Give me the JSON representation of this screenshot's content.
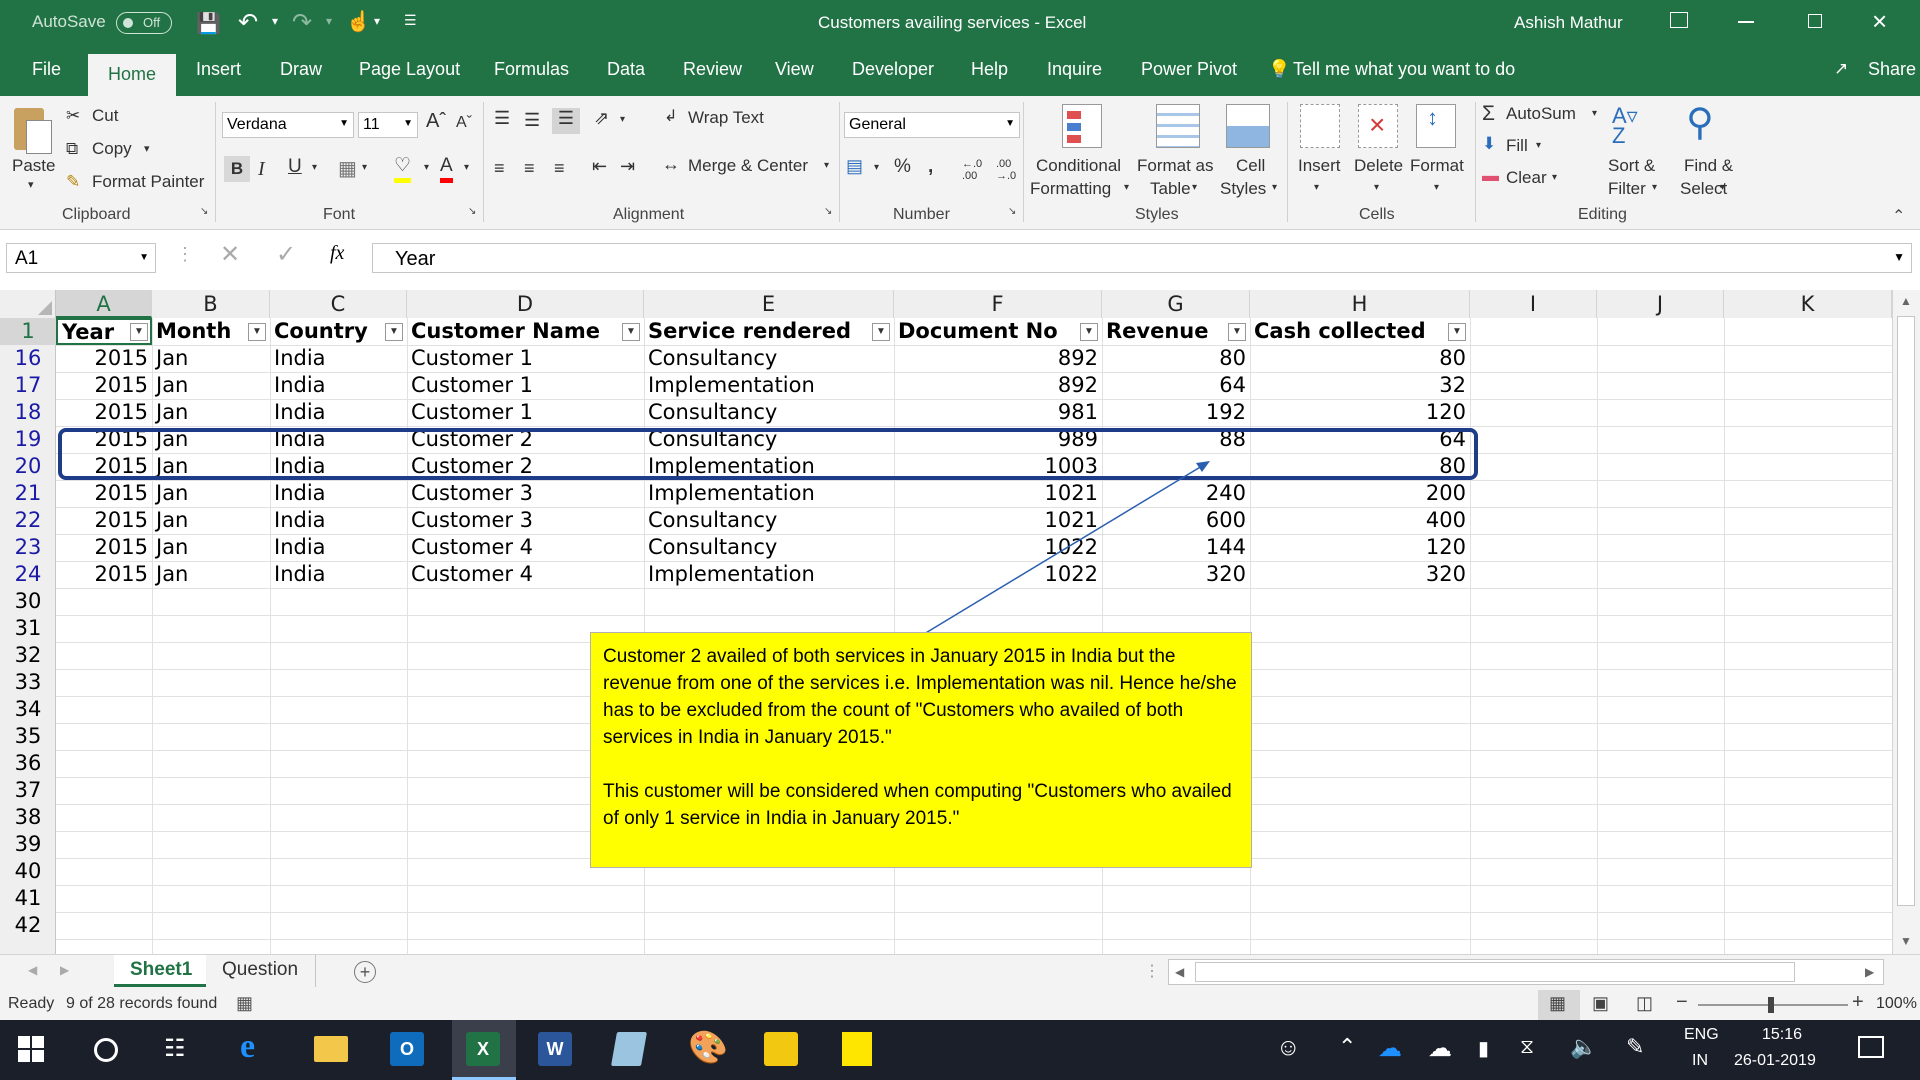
{
  "titlebar": {
    "autosave_label": "AutoSave",
    "autosave_state": "Off",
    "title": "Customers availing services  -  Excel",
    "user": "Ashish Mathur"
  },
  "tabs": [
    "File",
    "Home",
    "Insert",
    "Draw",
    "Page Layout",
    "Formulas",
    "Data",
    "Review",
    "View",
    "Developer",
    "Help",
    "Inquire",
    "Power Pivot"
  ],
  "tell_me": "Tell me what you want to do",
  "share": "Share",
  "ribbon": {
    "clipboard": {
      "paste": "Paste",
      "cut": "Cut",
      "copy": "Copy",
      "format_painter": "Format Painter",
      "label": "Clipboard"
    },
    "font": {
      "name": "Verdana",
      "size": "11",
      "label": "Font"
    },
    "alignment": {
      "wrap": "Wrap Text",
      "merge": "Merge & Center",
      "label": "Alignment"
    },
    "number": {
      "format": "General",
      "label": "Number"
    },
    "styles": {
      "cond1": "Conditional",
      "cond2": "Formatting",
      "fmt1": "Format as",
      "fmt2": "Table",
      "cell1": "Cell",
      "cell2": "Styles",
      "label": "Styles"
    },
    "cells": {
      "insert": "Insert",
      "delete": "Delete",
      "format": "Format",
      "label": "Cells"
    },
    "editing": {
      "autosum": "AutoSum",
      "fill": "Fill",
      "clear": "Clear",
      "sort1": "Sort &",
      "sort2": "Filter",
      "find1": "Find &",
      "find2": "Select",
      "label": "Editing"
    }
  },
  "formula_bar": {
    "name_box": "A1",
    "fx": "fx",
    "value": "Year"
  },
  "columns": [
    "A",
    "B",
    "C",
    "D",
    "E",
    "F",
    "G",
    "H",
    "I",
    "J",
    "K"
  ],
  "headers": [
    "Year",
    "Month",
    "Country",
    "Customer Name",
    "Service rendered",
    "Document No",
    "Revenue",
    "Cash collected"
  ],
  "rows": [
    {
      "n": "16",
      "year": "2015",
      "month": "Jan",
      "country": "India",
      "customer": "Customer 1",
      "service": "Consultancy",
      "doc": "892",
      "revenue": "80",
      "cash": "80"
    },
    {
      "n": "17",
      "year": "2015",
      "month": "Jan",
      "country": "India",
      "customer": "Customer 1",
      "service": "Implementation",
      "doc": "892",
      "revenue": "64",
      "cash": "32"
    },
    {
      "n": "18",
      "year": "2015",
      "month": "Jan",
      "country": "India",
      "customer": "Customer 1",
      "service": "Consultancy",
      "doc": "981",
      "revenue": "192",
      "cash": "120"
    },
    {
      "n": "19",
      "year": "2015",
      "month": "Jan",
      "country": "India",
      "customer": "Customer 2",
      "service": "Consultancy",
      "doc": "989",
      "revenue": "88",
      "cash": "64"
    },
    {
      "n": "20",
      "year": "2015",
      "month": "Jan",
      "country": "India",
      "customer": "Customer 2",
      "service": "Implementation",
      "doc": "1003",
      "revenue": "",
      "cash": "80"
    },
    {
      "n": "21",
      "year": "2015",
      "month": "Jan",
      "country": "India",
      "customer": "Customer 3",
      "service": "Implementation",
      "doc": "1021",
      "revenue": "240",
      "cash": "200"
    },
    {
      "n": "22",
      "year": "2015",
      "month": "Jan",
      "country": "India",
      "customer": "Customer 3",
      "service": "Consultancy",
      "doc": "1021",
      "revenue": "600",
      "cash": "400"
    },
    {
      "n": "23",
      "year": "2015",
      "month": "Jan",
      "country": "India",
      "customer": "Customer 4",
      "service": "Consultancy",
      "doc": "1022",
      "revenue": "144",
      "cash": "120"
    },
    {
      "n": "24",
      "year": "2015",
      "month": "Jan",
      "country": "India",
      "customer": "Customer 4",
      "service": "Implementation",
      "doc": "1022",
      "revenue": "320",
      "cash": "320"
    }
  ],
  "empty_rows": [
    "30",
    "31",
    "32",
    "33",
    "34",
    "35",
    "36",
    "37",
    "38",
    "39",
    "40",
    "41",
    "42"
  ],
  "note": {
    "p1": "Customer 2 availed of both services in January 2015 in India but the revenue from one of the services i.e. Implementation was nil.  Hence he/she has to be excluded from the count of \"Customers who availed of both services in India in January 2015.\"",
    "p2": "This customer will be considered when computing \"Customers who availed of only 1 service in India in January 2015.\""
  },
  "sheets": [
    "Sheet1",
    "Question"
  ],
  "status": {
    "ready": "Ready",
    "records": "9 of 28 records found",
    "zoom": "100%"
  },
  "taskbar": {
    "lang1": "ENG",
    "lang2": "IN",
    "time": "15:16",
    "date": "26-01-2019"
  },
  "colors": {
    "excel_green": "#217346",
    "highlight_border": "#1f3c88",
    "note_bg": "#ffff00",
    "row_num_blue": "#1a1aa6"
  }
}
